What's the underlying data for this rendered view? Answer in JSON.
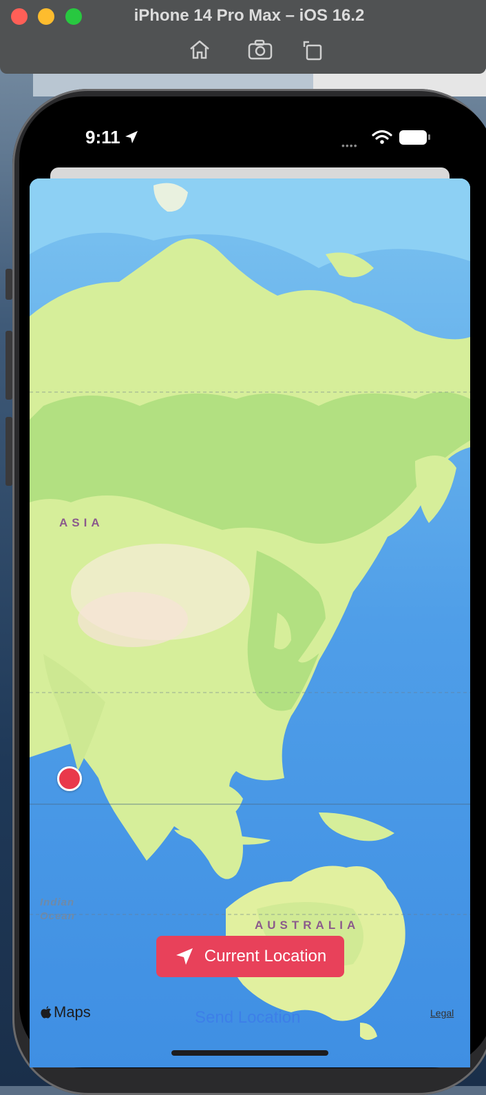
{
  "window": {
    "title": "iPhone 14 Pro Max – iOS 16.2"
  },
  "toolbar": {
    "icons": [
      "home-icon",
      "screenshot-icon",
      "rotate-icon"
    ]
  },
  "status_bar": {
    "time": "9:11",
    "dots": "••••"
  },
  "map": {
    "labels": {
      "asia": "ASIA",
      "australia": "AUSTRALIA",
      "ocean": "Indian\nOcean"
    }
  },
  "actions": {
    "current_location": "Current Location",
    "send_location": "Send Location"
  },
  "footer": {
    "maps": "Maps",
    "legal": "Legal"
  },
  "colors": {
    "accent_red": "#e8415a",
    "link_blue": "#3d7fe8",
    "pin_red": "#e9394b"
  }
}
